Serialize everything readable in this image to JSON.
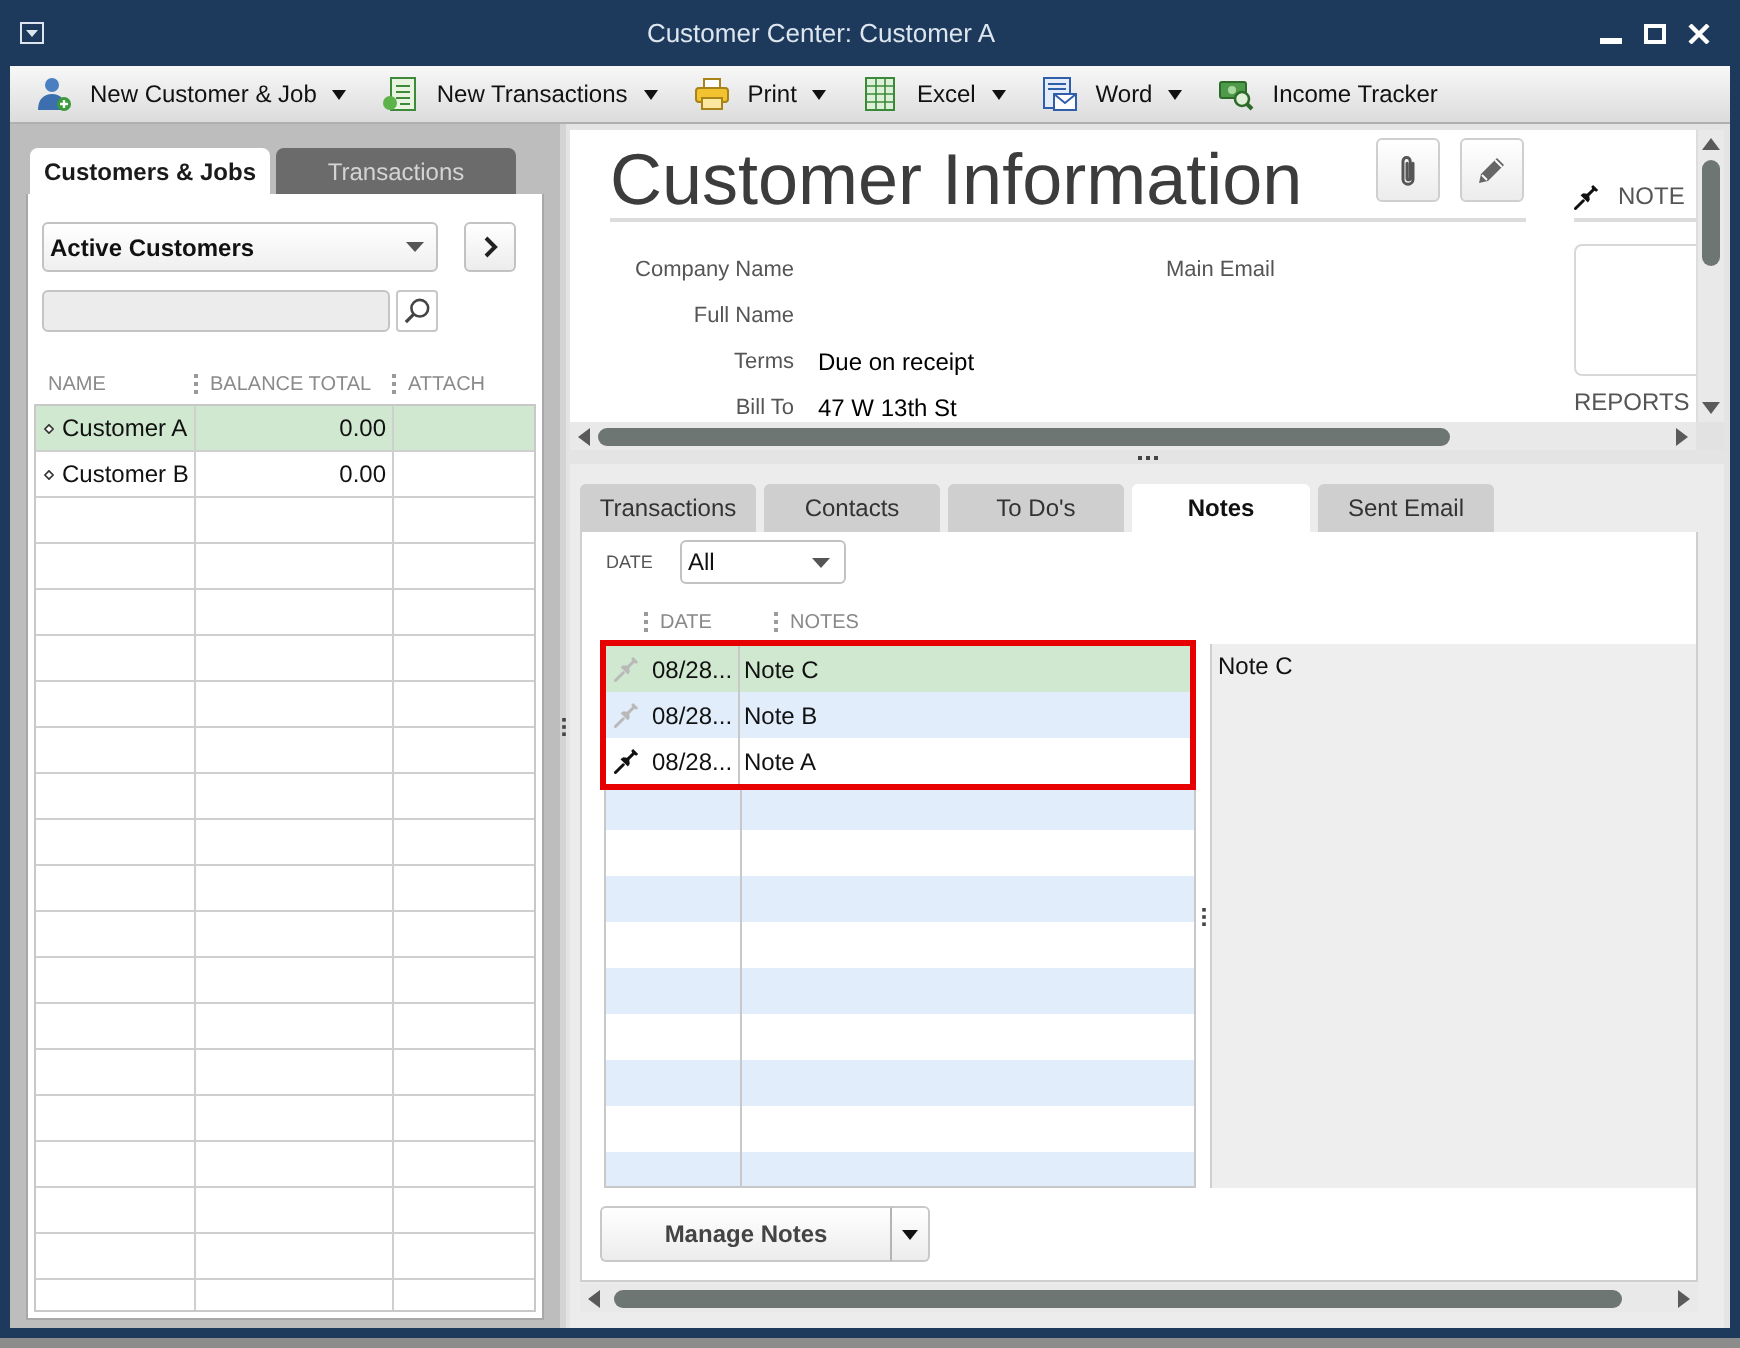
{
  "window": {
    "title": "Customer Center: Customer A"
  },
  "toolbar": [
    {
      "label": "New Customer & Job",
      "kind": "customer",
      "has_menu": true
    },
    {
      "label": "New Transactions",
      "kind": "transaction",
      "has_menu": true
    },
    {
      "label": "Print",
      "kind": "print",
      "has_menu": true
    },
    {
      "label": "Excel",
      "kind": "spreadsheet",
      "has_menu": true
    },
    {
      "label": "Word",
      "kind": "letter",
      "has_menu": true
    },
    {
      "label": "Income Tracker",
      "kind": "tracker",
      "has_menu": false
    }
  ],
  "customers_panel": {
    "tabs": [
      {
        "label": "Customers & Jobs",
        "selected": true
      },
      {
        "label": "Transactions",
        "selected": false
      }
    ],
    "filter": "Active Customers",
    "table": {
      "columns": [
        "NAME",
        "BALANCE TOTAL",
        "ATTACH"
      ],
      "rows": [
        {
          "name": "Customer A",
          "balance_total": "0.00",
          "selected": true
        },
        {
          "name": "Customer B",
          "balance_total": "0.00",
          "selected": false
        }
      ]
    }
  },
  "customer_info": {
    "title": "Customer Information",
    "fields": [
      {
        "label": "Company Name"
      },
      {
        "label": "Full Name"
      },
      {
        "label": "Terms",
        "value": "Due on receipt"
      },
      {
        "label": "Bill To",
        "value": "47 W 13th St"
      }
    ],
    "contact_fields": [
      {
        "label": "Main Email"
      }
    ],
    "note_heading": "NOTE",
    "reports_heading": "REPORTS"
  },
  "detail_tabs": [
    {
      "label": "Transactions",
      "selected": false
    },
    {
      "label": "Contacts",
      "selected": false
    },
    {
      "label": "To Do's",
      "selected": false
    },
    {
      "label": "Notes",
      "selected": true
    },
    {
      "label": "Sent Email",
      "selected": false
    }
  ],
  "notes": {
    "date_filter": {
      "label": "DATE",
      "value": "All"
    },
    "columns": [
      "DATE",
      "NOTES"
    ],
    "rows": [
      {
        "date": "08/28...",
        "text": "Note C",
        "pinned": false,
        "selected": true,
        "highlighted": true
      },
      {
        "date": "08/28...",
        "text": "Note B",
        "pinned": false,
        "selected": false,
        "highlighted": true
      },
      {
        "date": "08/28...",
        "text": "Note A",
        "pinned": true,
        "selected": false,
        "highlighted": true
      }
    ],
    "preview": "Note C",
    "manage_button": "Manage Notes"
  }
}
